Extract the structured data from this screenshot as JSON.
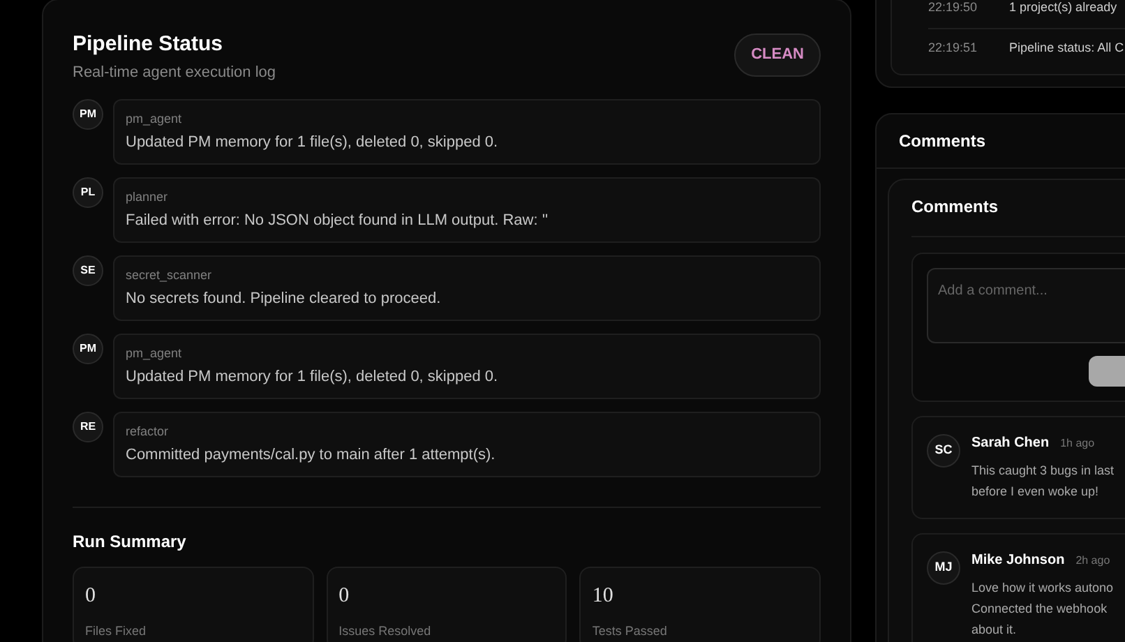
{
  "pipeline": {
    "title": "Pipeline Status",
    "subtitle": "Real-time agent execution log",
    "badge": "CLEAN",
    "log": [
      {
        "initials": "PM",
        "agent": "pm_agent",
        "message": "Updated PM memory for 1 file(s), deleted 0, skipped 0."
      },
      {
        "initials": "PL",
        "agent": "planner",
        "message": "Failed with error: No JSON object found in LLM output. Raw: ''"
      },
      {
        "initials": "SE",
        "agent": "secret_scanner",
        "message": "No secrets found. Pipeline cleared to proceed."
      },
      {
        "initials": "PM",
        "agent": "pm_agent",
        "message": "Updated PM memory for 1 file(s), deleted 0, skipped 0."
      },
      {
        "initials": "RE",
        "agent": "refactor",
        "message": "Committed payments/cal.py to main after 1 attempt(s)."
      }
    ],
    "summary": {
      "title": "Run Summary",
      "stats": [
        {
          "value": "0",
          "label": "Files Fixed"
        },
        {
          "value": "0",
          "label": "Issues Resolved"
        },
        {
          "value": "10",
          "label": "Tests Passed"
        }
      ]
    }
  },
  "activity": [
    {
      "time": "22:19:50",
      "text": "1 project(s) already"
    },
    {
      "time": "22:19:51",
      "text": "Pipeline status: All C"
    }
  ],
  "comments": {
    "header": "Comments",
    "title": "Comments",
    "placeholder": "Add a comment...",
    "items": [
      {
        "initials": "SC",
        "author": "Sarah Chen",
        "time": "1h ago",
        "lines": [
          "This caught 3 bugs in last",
          "before I even woke up!"
        ]
      },
      {
        "initials": "MJ",
        "author": "Mike Johnson",
        "time": "2h ago",
        "lines": [
          "Love how it works autono",
          "Connected the webhook",
          "about it."
        ]
      }
    ]
  }
}
